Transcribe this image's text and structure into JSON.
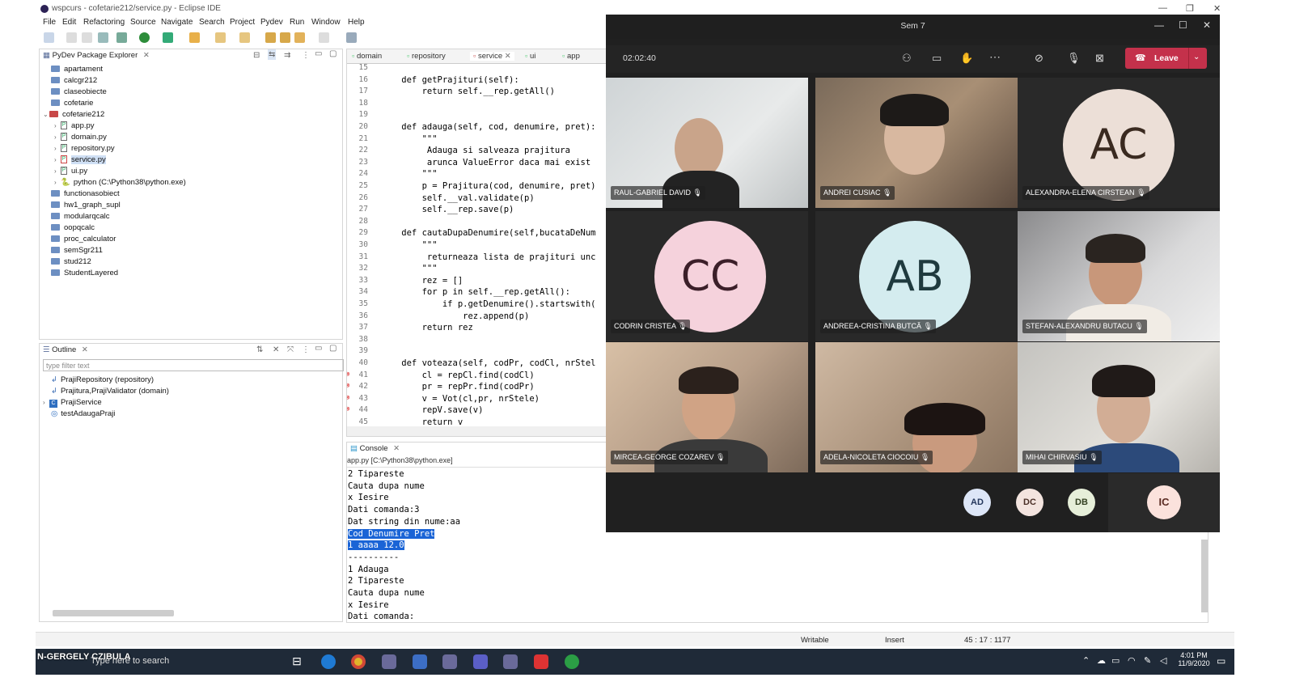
{
  "eclipse": {
    "title": "wspcurs - cofetarie212/service.py - Eclipse IDE",
    "menu": [
      "File",
      "Edit",
      "Refactoring",
      "Source",
      "Navigate",
      "Search",
      "Project",
      "Pydev",
      "Run",
      "Window",
      "Help"
    ],
    "package_explorer": {
      "title": "PyDev Package Explorer",
      "items": [
        "apartament",
        "calcgr212",
        "claseobiecte",
        "cofetarie",
        "cofetarie212",
        "app.py",
        "domain.py",
        "repository.py",
        "service.py",
        "ui.py",
        "python (C:\\Python38\\python.exe)",
        "functionasobiect",
        "hw1_graph_supl",
        "modularqcalc",
        "oopqcalc",
        "proc_calculator",
        "semSgr211",
        "stud212",
        "StudentLayered"
      ]
    },
    "outline": {
      "title": "Outline",
      "filter_placeholder": "type filter text",
      "items": [
        "PrajiRepository (repository)",
        "Prajitura,PrajiValidator (domain)",
        "PrajiService",
        "testAdaugaPraji"
      ]
    },
    "editor_tabs": [
      "domain",
      "repository",
      "service",
      "ui",
      "app"
    ],
    "code_lines": [
      {
        "n": "15",
        "t": ""
      },
      {
        "n": "16",
        "t": "    def getPrajituri(self):"
      },
      {
        "n": "17",
        "t": "        return self.__rep.getAll()"
      },
      {
        "n": "18",
        "t": ""
      },
      {
        "n": "19",
        "t": ""
      },
      {
        "n": "20",
        "t": "    def adauga(self, cod, denumire, pret):"
      },
      {
        "n": "21",
        "t": "        \"\"\""
      },
      {
        "n": "22",
        "t": "         Adauga si salveaza prajitura"
      },
      {
        "n": "23",
        "t": "         arunca ValueError daca mai exist"
      },
      {
        "n": "24",
        "t": "        \"\"\""
      },
      {
        "n": "25",
        "t": "        p = Prajitura(cod, denumire, pret)"
      },
      {
        "n": "26",
        "t": "        self.__val.validate(p)"
      },
      {
        "n": "27",
        "t": "        self.__rep.save(p)"
      },
      {
        "n": "28",
        "t": ""
      },
      {
        "n": "29",
        "t": "    def cautaDupaDenumire(self,bucataDeNum"
      },
      {
        "n": "30",
        "t": "        \"\"\""
      },
      {
        "n": "31",
        "t": "         returneaza lista de prajituri unc"
      },
      {
        "n": "32",
        "t": "        \"\"\""
      },
      {
        "n": "33",
        "t": "        rez = []"
      },
      {
        "n": "34",
        "t": "        for p in self.__rep.getAll():"
      },
      {
        "n": "35",
        "t": "            if p.getDenumire().startswith("
      },
      {
        "n": "36",
        "t": "                rez.append(p)"
      },
      {
        "n": "37",
        "t": "        return rez"
      },
      {
        "n": "38",
        "t": ""
      },
      {
        "n": "39",
        "t": ""
      },
      {
        "n": "40",
        "t": "    def voteaza(self, codPr, codCl, nrStel"
      },
      {
        "n": "41",
        "t": "        cl = repCl.find(codCl)"
      },
      {
        "n": "42",
        "t": "        pr = repPr.find(codPr)"
      },
      {
        "n": "43",
        "t": "        v = Vot(cl,pr, nrStele)"
      },
      {
        "n": "44",
        "t": "        repV.save(v)"
      },
      {
        "n": "45",
        "t": "        return v"
      }
    ],
    "console": {
      "title": "Console",
      "path": "app.py [C:\\Python38\\python.exe]",
      "lines": [
        "2 Tipareste",
        "Cauta dupa nume",
        "x Iesire",
        "Dati comanda:3",
        "Dat string din nume:aa",
        "Cod Denumire Pret",
        "1 aaaa 12.0",
        "----------",
        "1 Adauga",
        "2 Tipareste",
        "Cauta dupa nume",
        "x Iesire",
        "Dati comanda:"
      ]
    },
    "status": {
      "writable": "Writable",
      "insert": "Insert",
      "position": "45 : 17 : 1177"
    }
  },
  "teams": {
    "title": "Sem 7",
    "timer": "02:02:40",
    "leave_label": "Leave",
    "participants": [
      {
        "name": "RAUL-GABRIEL DAVID",
        "initials": ""
      },
      {
        "name": "ANDREI CUSIAC",
        "initials": ""
      },
      {
        "name": "ALEXANDRA-ELENA CIRSTEAN",
        "initials": "AC"
      },
      {
        "name": "CODRIN CRISTEA",
        "initials": "CC"
      },
      {
        "name": "ANDREEA-CRISTINA BUTCĂ",
        "initials": "AB"
      },
      {
        "name": "STEFAN-ALEXANDRU BUTACU",
        "initials": ""
      },
      {
        "name": "MIRCEA-GEORGE COZAREV",
        "initials": ""
      },
      {
        "name": "ADELA-NICOLETA CIOCOIU",
        "initials": ""
      },
      {
        "name": "MIHAI CHIRVASIU",
        "initials": ""
      }
    ],
    "small_avatars": [
      "AD",
      "DC",
      "DB",
      "IC"
    ]
  },
  "taskbar": {
    "presenter_label": "N-GERGELY CZIBULA",
    "search_placeholder": "Type here to search",
    "time": "4:01 PM",
    "date": "11/9/2020"
  },
  "colors": {
    "leave_red": "#c4314b",
    "selection_blue": "#1a64d6",
    "teams_bg": "#202020"
  }
}
